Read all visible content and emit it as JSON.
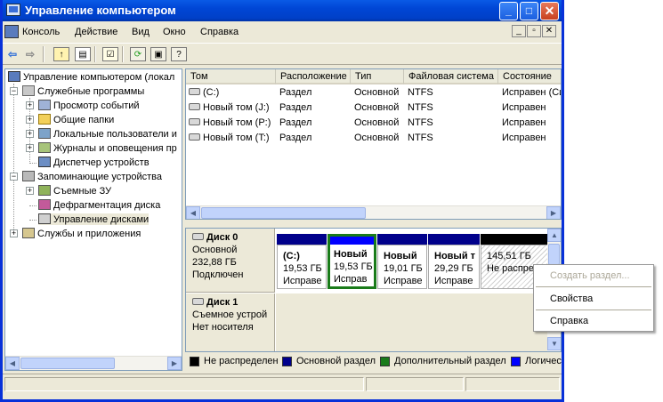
{
  "window": {
    "title": "Управление компьютером"
  },
  "titlebar_buttons": {
    "minimize": "_",
    "maximize": "□",
    "close": "✕"
  },
  "menu": {
    "items": [
      "Консоль",
      "Действие",
      "Вид",
      "Окно",
      "Справка"
    ]
  },
  "mdi_buttons": [
    "_",
    "▫",
    "✕"
  ],
  "toolbar": {
    "back": "⇦",
    "forward": "⇨"
  },
  "tree": {
    "root": "Управление компьютером (локал",
    "groups": [
      {
        "label": "Служебные программы",
        "sign": "−",
        "children": [
          {
            "label": "Просмотр событий",
            "sign": "+"
          },
          {
            "label": "Общие папки",
            "sign": "+"
          },
          {
            "label": "Локальные пользователи и",
            "sign": "+"
          },
          {
            "label": "Журналы и оповещения пр",
            "sign": "+"
          },
          {
            "label": "Диспетчер устройств",
            "sign": ""
          }
        ]
      },
      {
        "label": "Запоминающие устройства",
        "sign": "−",
        "children": [
          {
            "label": "Съемные ЗУ",
            "sign": "+"
          },
          {
            "label": "Дефрагментация диска",
            "sign": ""
          },
          {
            "label": "Управление дисками",
            "sign": ""
          }
        ]
      },
      {
        "label": "Службы и приложения",
        "sign": "+",
        "children": []
      }
    ]
  },
  "volumes": {
    "columns": [
      "Том",
      "Расположение",
      "Тип",
      "Файловая система",
      "Состояние"
    ],
    "rows": [
      [
        "(C:)",
        "Раздел",
        "Основной",
        "NTFS",
        "Исправен (Си"
      ],
      [
        "Новый том (J:)",
        "Раздел",
        "Основной",
        "NTFS",
        "Исправен"
      ],
      [
        "Новый том (P:)",
        "Раздел",
        "Основной",
        "NTFS",
        "Исправен"
      ],
      [
        "Новый том (T:)",
        "Раздел",
        "Основной",
        "NTFS",
        "Исправен"
      ]
    ]
  },
  "disks": [
    {
      "name": "Диск 0",
      "type": "Основной",
      "size": "232,88 ГБ",
      "status": "Подключен",
      "partitions": [
        {
          "name": "(C:)",
          "size": "19,53 ГБ",
          "status": "Исправе"
        },
        {
          "name": "Новый",
          "size": "19,53 ГБ",
          "status": "Исправ"
        },
        {
          "name": "Новый",
          "size": "19,01 ГБ",
          "status": "Исправе"
        },
        {
          "name": "Новый т",
          "size": "29,29 ГБ",
          "status": "Исправе"
        },
        {
          "name": "",
          "size": "145,51 ГБ",
          "status": "Не распреде"
        }
      ]
    },
    {
      "name": "Диск 1",
      "type": "Съемное устрой",
      "size": "",
      "status": "Нет носителя",
      "partitions": []
    }
  ],
  "legend": {
    "items": [
      {
        "label": "Не распределен",
        "color": "#000000"
      },
      {
        "label": "Основной раздел",
        "color": "#00008b"
      },
      {
        "label": "Дополнительный раздел",
        "color": "#1a7b1a"
      },
      {
        "label": "Логичес",
        "color": "#0000ff"
      }
    ]
  },
  "context_menu": {
    "items": [
      {
        "label": "Создать раздел...",
        "enabled": false
      },
      {
        "label": "Свойства",
        "enabled": true
      },
      {
        "label": "Справка",
        "enabled": true
      }
    ]
  },
  "colors": {
    "title_bar": "#0046d5",
    "primary_partition": "#00008b",
    "unallocated": "#000000",
    "extended_partition": "#1a7b1a",
    "logical_drive": "#0000ff",
    "window_bg": "#ece9d8"
  }
}
